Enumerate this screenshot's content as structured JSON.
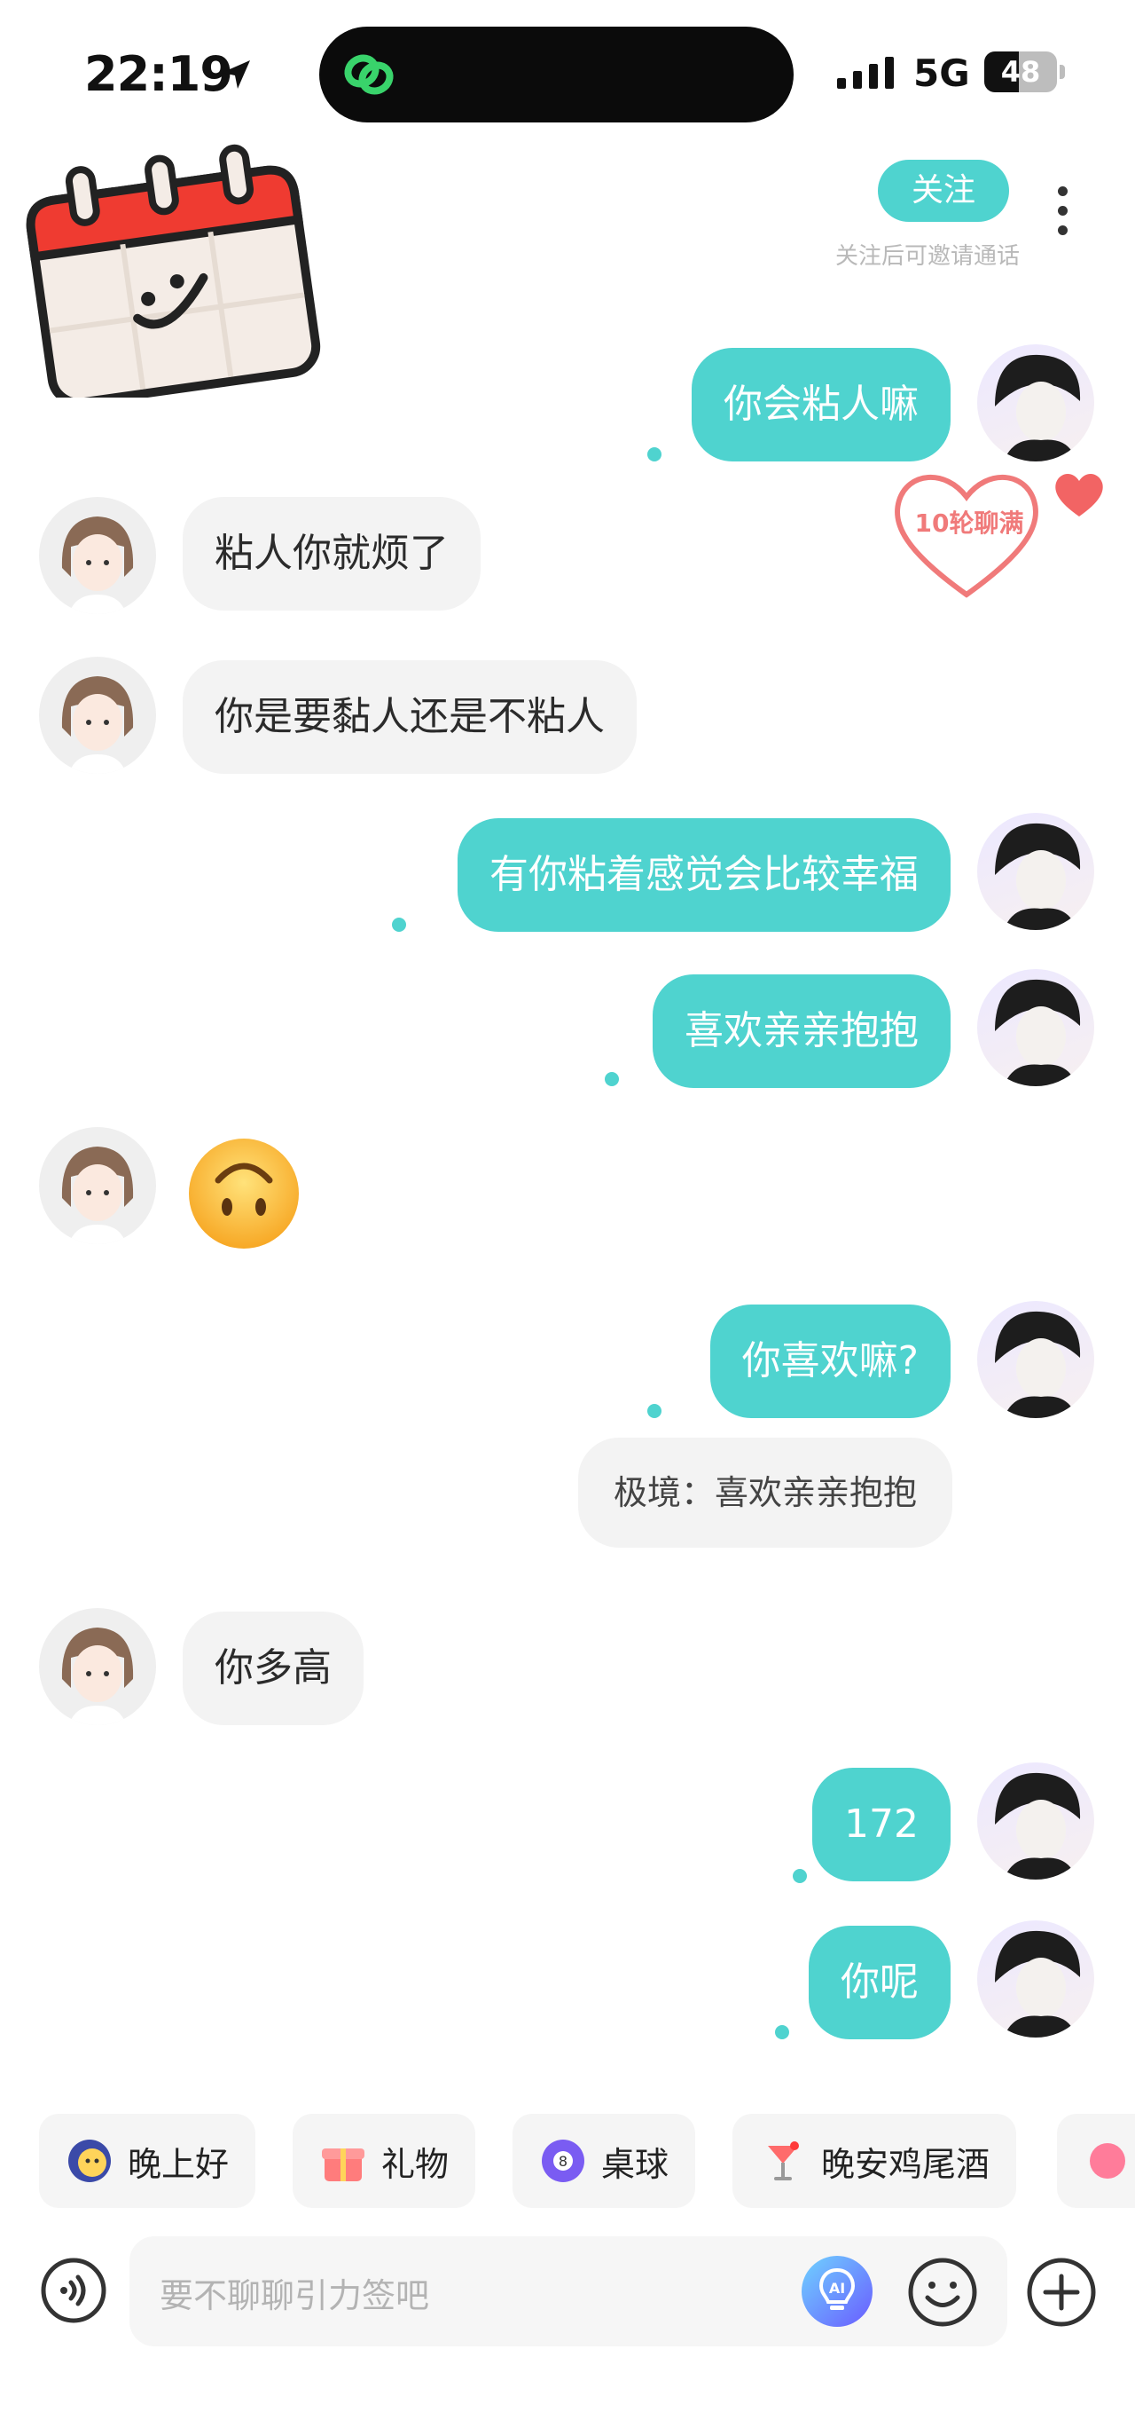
{
  "status_bar": {
    "time": "22:19",
    "network": "5G",
    "battery": "48",
    "battery_level": 0.48
  },
  "header": {
    "follow_label": "关注",
    "follow_hint": "关注后可邀请通话"
  },
  "badge": {
    "label": "10轮聊满"
  },
  "messages": [
    {
      "side": "out",
      "text": "你会粘人嘛"
    },
    {
      "side": "in",
      "text": "粘人你就烦了"
    },
    {
      "side": "in",
      "text": "你是要黏人还是不粘人"
    },
    {
      "side": "out",
      "text": "有你粘着感觉会比较幸福"
    },
    {
      "side": "out",
      "text": "喜欢亲亲抱抱"
    },
    {
      "side": "in",
      "emoji": "upside-down-face"
    },
    {
      "side": "out",
      "text": "你喜欢嘛?"
    },
    {
      "side": "out",
      "quote": "极境：喜欢亲亲抱抱"
    },
    {
      "side": "in",
      "text": "你多高"
    },
    {
      "side": "out",
      "text": "172"
    },
    {
      "side": "out",
      "text": "你呢"
    }
  ],
  "quick_actions": [
    {
      "label": "晚上好",
      "icon": "moon-face-icon"
    },
    {
      "label": "礼物",
      "icon": "gift-icon"
    },
    {
      "label": "桌球",
      "icon": "billiard-ball-icon"
    },
    {
      "label": "晚安鸡尾酒",
      "icon": "cocktail-icon"
    }
  ],
  "input": {
    "placeholder": "要不聊聊引力签吧"
  },
  "colors": {
    "accent": "#4fd3cf",
    "incoming_bubble": "#f3f3f3",
    "heart": "#f07a7a"
  }
}
